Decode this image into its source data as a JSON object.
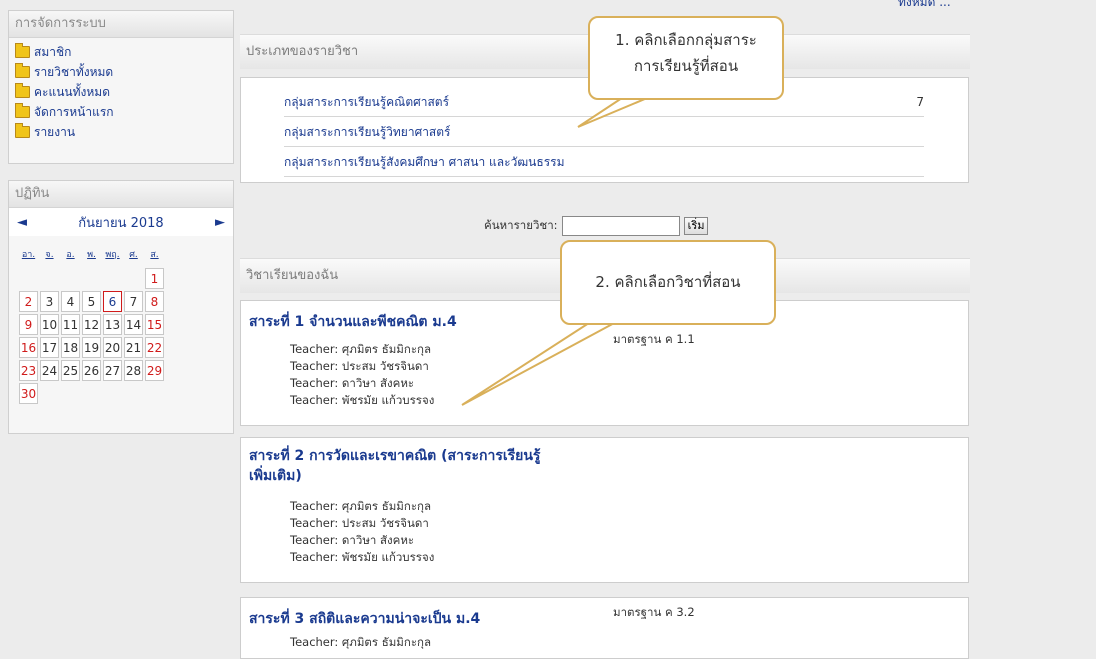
{
  "top_right_link": "ทั้งหมด ...",
  "admin": {
    "title": "การจัดการระบบ",
    "items": [
      {
        "label": "สมาชิก"
      },
      {
        "label": "รายวิชาทั้งหมด"
      },
      {
        "label": "คะแนนทั้งหมด"
      },
      {
        "label": "จัดการหน้าแรก"
      },
      {
        "label": "รายงาน"
      }
    ]
  },
  "calendar": {
    "title": "ปฏิทิน",
    "month": "กันยายน 2018",
    "prev": "◄",
    "next": "►",
    "weekdays": [
      "อา.",
      "จ.",
      "อ.",
      "พ.",
      "พฤ.",
      "ศ.",
      "ส."
    ],
    "days": [
      "1",
      "2",
      "3",
      "4",
      "5",
      "6",
      "7",
      "8",
      "9",
      "10",
      "11",
      "12",
      "13",
      "14",
      "15",
      "16",
      "17",
      "18",
      "19",
      "20",
      "21",
      "22",
      "23",
      "24",
      "25",
      "26",
      "27",
      "28",
      "29",
      "30"
    ]
  },
  "categories": {
    "title": "ประเภทของรายวิชา",
    "items": [
      {
        "label": "กลุ่มสาระการเรียนรู้คณิตศาสตร์",
        "count": "7"
      },
      {
        "label": "กลุ่มสาระการเรียนรู้วิทยาศาสตร์",
        "count": ""
      },
      {
        "label": "กลุ่มสาระการเรียนรู้สังคมศึกษา ศาสนา และวัฒนธรรม",
        "count": ""
      }
    ]
  },
  "search": {
    "label": "ค้นหารายวิชา:",
    "value": "",
    "button": "เริ่ม"
  },
  "my_courses": {
    "title": "วิชาเรียนของฉัน",
    "courses": [
      {
        "title": "สาระที่ 1 จำนวนและพีชคณิต ม.4",
        "standard": "มาตรฐาน ค 1.1",
        "teachers": [
          "Teacher: ศุภมิตร ธัมมิกะกุล",
          "Teacher: ประสม วัชรจินดา",
          "Teacher: ดาวิษา สังคหะ",
          "Teacher: พัชรมัย แก้วบรรจง"
        ]
      },
      {
        "title_line1": "สาระที่ 2 การวัดและเรขาคณิต (สาระการเรียนรู้",
        "title_line2": "เพิ่มเติม)",
        "standard": "",
        "teachers": [
          "Teacher: ศุภมิตร ธัมมิกะกุล",
          "Teacher: ประสม วัชรจินดา",
          "Teacher: ดาวิษา สังคหะ",
          "Teacher: พัชรมัย แก้วบรรจง"
        ]
      },
      {
        "title": "สาระที่ 3 สถิติและความน่าจะเป็น ม.4",
        "standard": "มาตรฐาน ค 3.2",
        "teachers": [
          "Teacher: ศุภมิตร ธัมมิกะกุล"
        ]
      }
    ]
  },
  "callouts": {
    "one_line1": "1. คลิกเลือกกลุ่มสาระ",
    "one_line2": "การเรียนรู้ที่สอน",
    "two": "2. คลิกเลือกวิชาที่สอน"
  }
}
